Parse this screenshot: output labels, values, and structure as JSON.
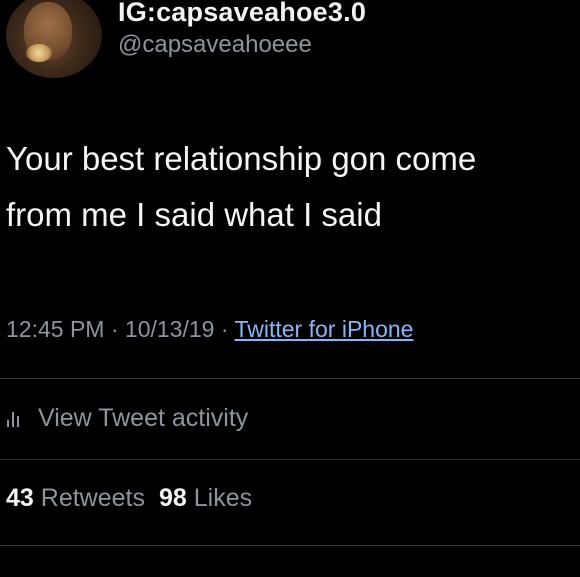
{
  "user": {
    "display_name": "IG:capsaveahoe3.0",
    "handle": "@capsaveahoeee"
  },
  "tweet": {
    "text": "Your best relationship gon come\nfrom me I said what I said"
  },
  "meta": {
    "time": "12:45 PM",
    "date": "10/13/19",
    "separator": "·",
    "source": "Twitter for iPhone"
  },
  "activity": {
    "icon": "bar-chart-icon",
    "label": "View Tweet activity"
  },
  "stats": {
    "retweets_count": "43",
    "retweets_label": "Retweets",
    "likes_count": "98",
    "likes_label": "Likes"
  },
  "colors": {
    "background": "#000000",
    "primary_text": "#f5f5f5",
    "secondary_text": "#8d949b",
    "link": "#8ab4f8",
    "divider": "#2f3336"
  }
}
